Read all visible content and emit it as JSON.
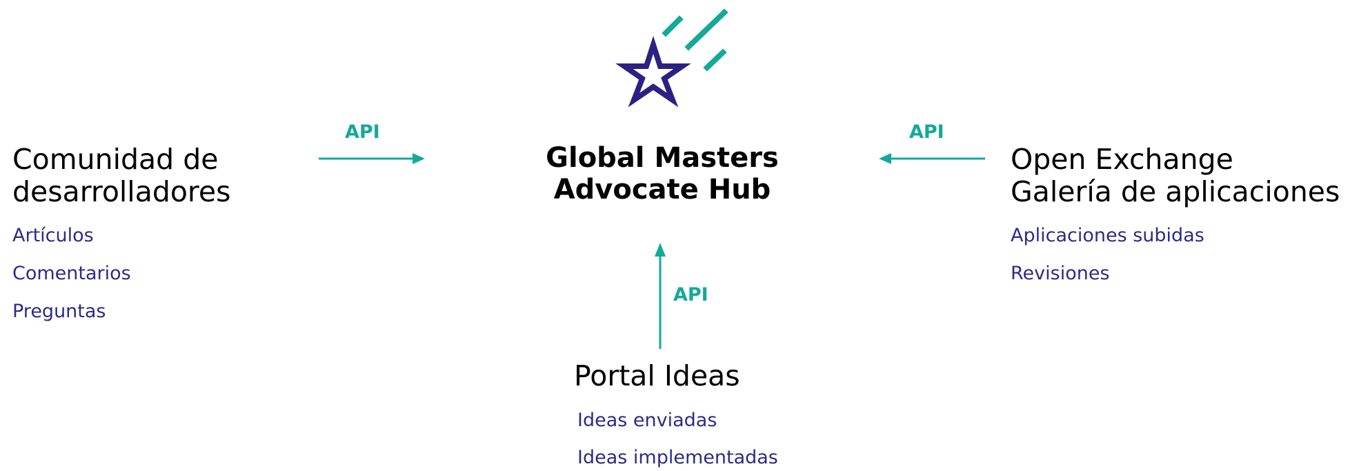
{
  "hub": {
    "title_line1": "Global Masters",
    "title_line2": "Advocate Hub",
    "icon": "shooting-star-icon"
  },
  "left_node": {
    "title_line1": "Comunidad de",
    "title_line2": "desarrolladores",
    "items": [
      "Artículos",
      "Comentarios",
      "Preguntas"
    ]
  },
  "right_node": {
    "title_line1": "Open Exchange",
    "title_line2": "Galería de aplicaciones",
    "items": [
      "Aplicaciones subidas",
      "Revisiones"
    ]
  },
  "bottom_node": {
    "title": "Portal Ideas",
    "items": [
      "Ideas enviadas",
      "Ideas implementadas"
    ]
  },
  "connectors": {
    "left_label": "API",
    "right_label": "API",
    "bottom_label": "API"
  },
  "colors": {
    "accent_teal": "#14a99a",
    "star_navy": "#2b2183",
    "item_text": "#2e2a8a",
    "title_text": "#000000"
  }
}
